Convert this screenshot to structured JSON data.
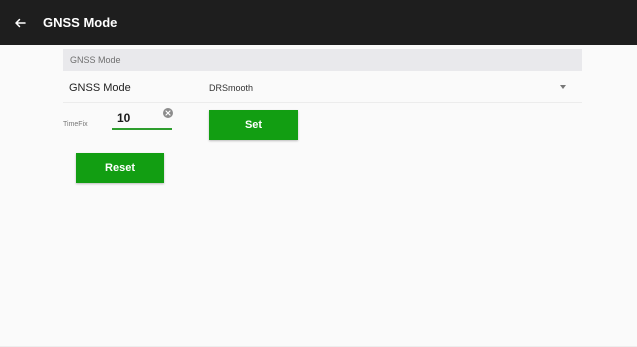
{
  "appbar": {
    "title": "GNSS Mode",
    "back_icon": "arrow-left-icon",
    "background": "#1e1e1e"
  },
  "section": {
    "header": "GNSS Mode"
  },
  "mode": {
    "label": "GNSS Mode",
    "selected": "DRSmooth",
    "dropdown_icon": "chevron-down-icon"
  },
  "timefix": {
    "label": "TimeFix",
    "value": "10",
    "clear_icon": "clear-icon"
  },
  "buttons": {
    "set_label": "Set",
    "reset_label": "Reset",
    "color": "#129e12"
  },
  "accent": "#2e9e2e"
}
